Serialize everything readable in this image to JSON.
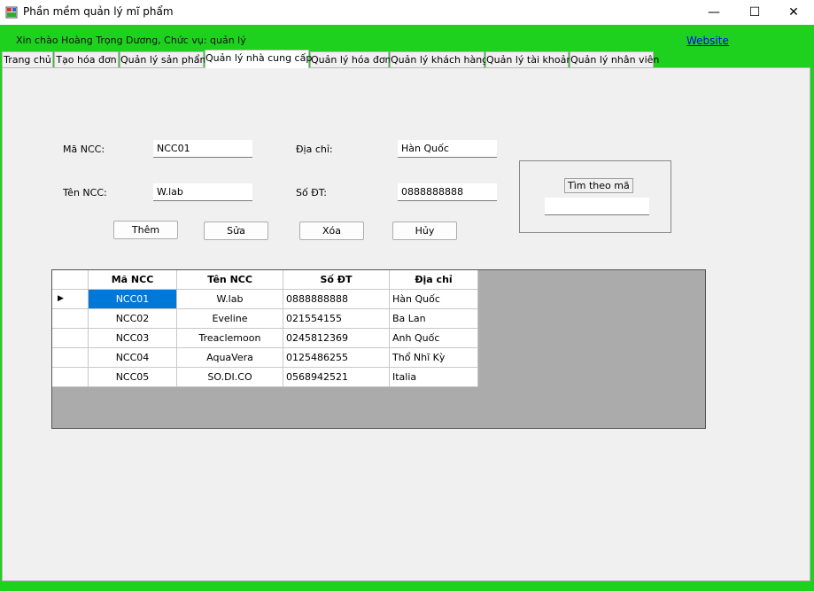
{
  "window": {
    "title": "Phần mềm quản lý mĩ phẩm",
    "minimize": "—",
    "maximize": "☐",
    "close": "✕"
  },
  "header": {
    "greeting": "Xin chào Hoàng Trọng Dương, Chức vụ: quản lý",
    "website_label": "Website"
  },
  "tabs": [
    {
      "label": "Trang chủ"
    },
    {
      "label": "Tạo hóa đơn"
    },
    {
      "label": "Quản lý sản phẩm"
    },
    {
      "label": "Quản lý nhà cung cấp",
      "active": true
    },
    {
      "label": "Quản lý hóa đơn"
    },
    {
      "label": "Quản lý khách hàng"
    },
    {
      "label": "Quản lý tài khoản"
    },
    {
      "label": "Quản lý nhân viên"
    }
  ],
  "form": {
    "ma_ncc_label": "Mã NCC:",
    "ma_ncc_value": "NCC01",
    "ten_ncc_label": "Tên NCC:",
    "ten_ncc_value": "W.lab",
    "dia_chi_label": "Địa chỉ:",
    "dia_chi_value": "Hàn Quốc",
    "so_dt_label": "Số ĐT:",
    "so_dt_value": "0888888888"
  },
  "buttons": {
    "add": "Thêm",
    "edit": "Sửa",
    "delete": "Xóa",
    "cancel": "Hủy"
  },
  "search": {
    "title": "Tìm theo mã",
    "value": ""
  },
  "grid": {
    "columns": [
      "Mã NCC",
      "Tên NCC",
      "Số ĐT",
      "Địa chỉ"
    ],
    "rows": [
      [
        "NCC01",
        "W.lab",
        "0888888888",
        "Hàn Quốc"
      ],
      [
        "NCC02",
        "Eveline",
        "021554155",
        "Ba Lan"
      ],
      [
        "NCC03",
        "Treaclemoon",
        "0245812369",
        "Anh Quốc"
      ],
      [
        "NCC04",
        "AquaVera",
        "0125486255",
        "Thổ Nhĩ Kỳ"
      ],
      [
        "NCC05",
        "SO.DI.CO",
        "0568942521",
        "Italia"
      ]
    ],
    "selected_row": 0,
    "row_indicator": "▶"
  },
  "colors": {
    "accent_green": "#1fd11f",
    "selection_blue": "#0078d7",
    "link_blue": "#0000ee"
  }
}
